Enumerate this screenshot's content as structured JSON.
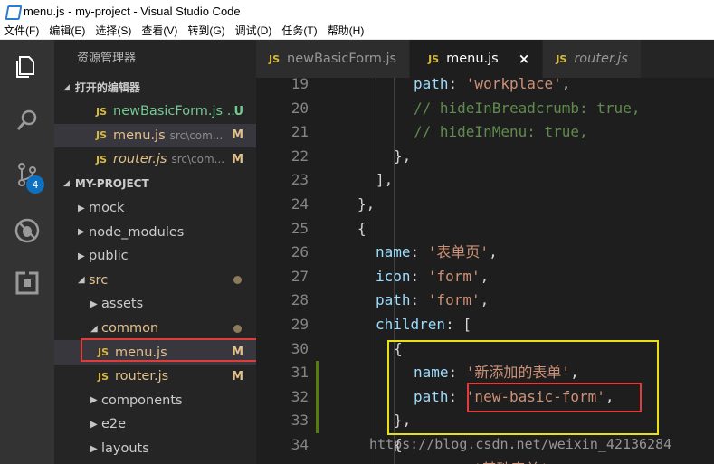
{
  "window": {
    "title": "menu.js - my-project - Visual Studio Code"
  },
  "menu": [
    "文件(F)",
    "编辑(E)",
    "选择(S)",
    "查看(V)",
    "转到(G)",
    "调试(D)",
    "任务(T)",
    "帮助(H)"
  ],
  "activity": {
    "scm_badge": "4",
    "icons": [
      "explorer-icon",
      "search-icon",
      "source-control-icon",
      "debug-icon",
      "extensions-icon"
    ]
  },
  "sidebar": {
    "title": "资源管理器",
    "open_editors": {
      "header": "打开的编辑器",
      "items": [
        {
          "icon": "JS",
          "name": "newBasicForm.js ...",
          "path": "",
          "status": "U"
        },
        {
          "icon": "JS",
          "name": "menu.js",
          "path": "src\\com...",
          "status": "M"
        },
        {
          "icon": "JS",
          "name": "router.js",
          "path": "src\\com...",
          "status": "M"
        }
      ]
    },
    "project": {
      "header": "MY-PROJECT",
      "items": [
        {
          "name": "mock"
        },
        {
          "name": "node_modules"
        },
        {
          "name": "public"
        },
        {
          "name": "src"
        },
        {
          "name": "assets"
        },
        {
          "name": "common"
        },
        {
          "icon": "JS",
          "name": "menu.js",
          "status": "M"
        },
        {
          "icon": "JS",
          "name": "router.js",
          "status": "M"
        },
        {
          "name": "components"
        },
        {
          "name": "e2e"
        },
        {
          "name": "layouts"
        }
      ]
    }
  },
  "tabs": [
    {
      "icon": "JS",
      "label": "newBasicForm.js"
    },
    {
      "icon": "JS",
      "label": "menu.js",
      "close": "×"
    },
    {
      "icon": "JS",
      "label": "router.js"
    }
  ],
  "editor": {
    "lines": [
      {
        "n": "19",
        "t": [
          [
            "k",
            "path"
          ],
          [
            "p",
            ": "
          ],
          [
            "s",
            "'workplace'"
          ],
          [
            "p",
            ","
          ]
        ]
      },
      {
        "n": "20",
        "t": [
          [
            "c",
            "// hideInBreadcrumb: true,"
          ]
        ]
      },
      {
        "n": "21",
        "t": [
          [
            "c",
            "// hideInMenu: true,"
          ]
        ]
      },
      {
        "n": "22",
        "t": [
          [
            "p",
            "},"
          ]
        ]
      },
      {
        "n": "23",
        "t": [
          [
            "p",
            "],"
          ]
        ]
      },
      {
        "n": "24",
        "t": [
          [
            "p",
            "},"
          ]
        ]
      },
      {
        "n": "25",
        "t": [
          [
            "p",
            "{"
          ]
        ]
      },
      {
        "n": "26",
        "t": [
          [
            "k",
            "name"
          ],
          [
            "p",
            ": "
          ],
          [
            "s",
            "'表单页'"
          ],
          [
            "p",
            ","
          ]
        ]
      },
      {
        "n": "27",
        "t": [
          [
            "k",
            "icon"
          ],
          [
            "p",
            ": "
          ],
          [
            "s",
            "'form'"
          ],
          [
            "p",
            ","
          ]
        ]
      },
      {
        "n": "28",
        "t": [
          [
            "k",
            "path"
          ],
          [
            "p",
            ": "
          ],
          [
            "s",
            "'form'"
          ],
          [
            "p",
            ","
          ]
        ]
      },
      {
        "n": "29",
        "t": [
          [
            "k",
            "children"
          ],
          [
            "p",
            ": ["
          ]
        ]
      },
      {
        "n": "30",
        "t": [
          [
            "p",
            "{"
          ]
        ]
      },
      {
        "n": "31",
        "t": [
          [
            "k",
            "name"
          ],
          [
            "p",
            ": "
          ],
          [
            "s",
            "'新添加的表单'"
          ],
          [
            "p",
            ","
          ]
        ]
      },
      {
        "n": "32",
        "t": [
          [
            "k",
            "path"
          ],
          [
            "p",
            ": "
          ],
          [
            "s",
            "'new-basic-form'"
          ],
          [
            "p",
            ","
          ]
        ]
      },
      {
        "n": "33",
        "t": [
          [
            "p",
            "},"
          ]
        ]
      },
      {
        "n": "34",
        "t": [
          [
            "p",
            "{"
          ]
        ]
      },
      {
        "n": "",
        "t": [
          [
            "s",
            "'基础表单'"
          ]
        ]
      }
    ],
    "watermark": "https://blog.csdn.net/weixin_42136284"
  }
}
